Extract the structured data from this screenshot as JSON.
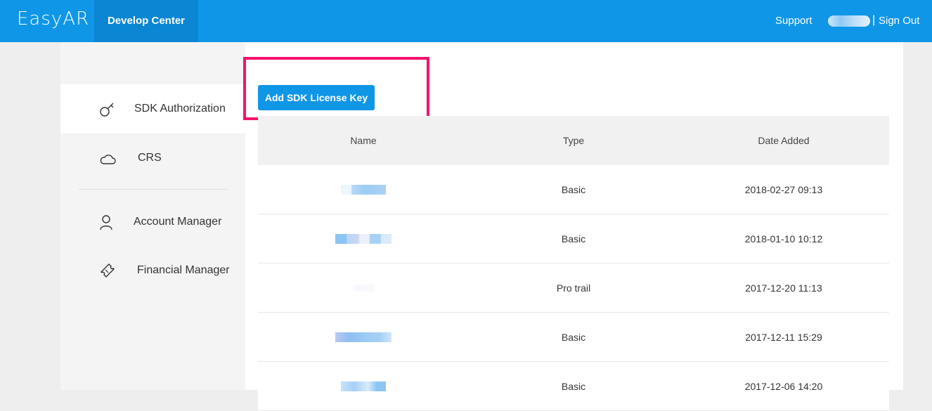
{
  "header": {
    "logo": "EasyAR",
    "nav_active": "Develop Center",
    "support": "Support",
    "separator": "|",
    "sign_out": "Sign Out"
  },
  "sidebar": {
    "items": [
      {
        "label": "SDK Authorization",
        "icon": "key-icon",
        "active": true
      },
      {
        "label": "CRS",
        "icon": "cloud-icon",
        "active": false
      },
      {
        "label": "Account Manager",
        "icon": "user-icon",
        "active": false
      },
      {
        "label": "Financial Manager",
        "icon": "ticket-icon",
        "active": false
      }
    ]
  },
  "main": {
    "add_button": "Add SDK License Key",
    "highlight_color": "#f4126e",
    "table": {
      "headers": [
        "Name",
        "Type",
        "Date Added"
      ],
      "rows": [
        {
          "name": "",
          "type": "Basic",
          "date": "2018-02-27 09:13"
        },
        {
          "name": "",
          "type": "Basic",
          "date": "2018-01-10 10:12"
        },
        {
          "name": "",
          "type": "Pro trail",
          "date": "2017-12-20 11:13"
        },
        {
          "name": "",
          "type": "Basic",
          "date": "2017-12-11 15:29"
        },
        {
          "name": "",
          "type": "Basic",
          "date": "2017-12-06 14:20"
        }
      ]
    }
  },
  "colors": {
    "brand": "#0f96e6",
    "nav_active_bg": "#0a86d2"
  }
}
